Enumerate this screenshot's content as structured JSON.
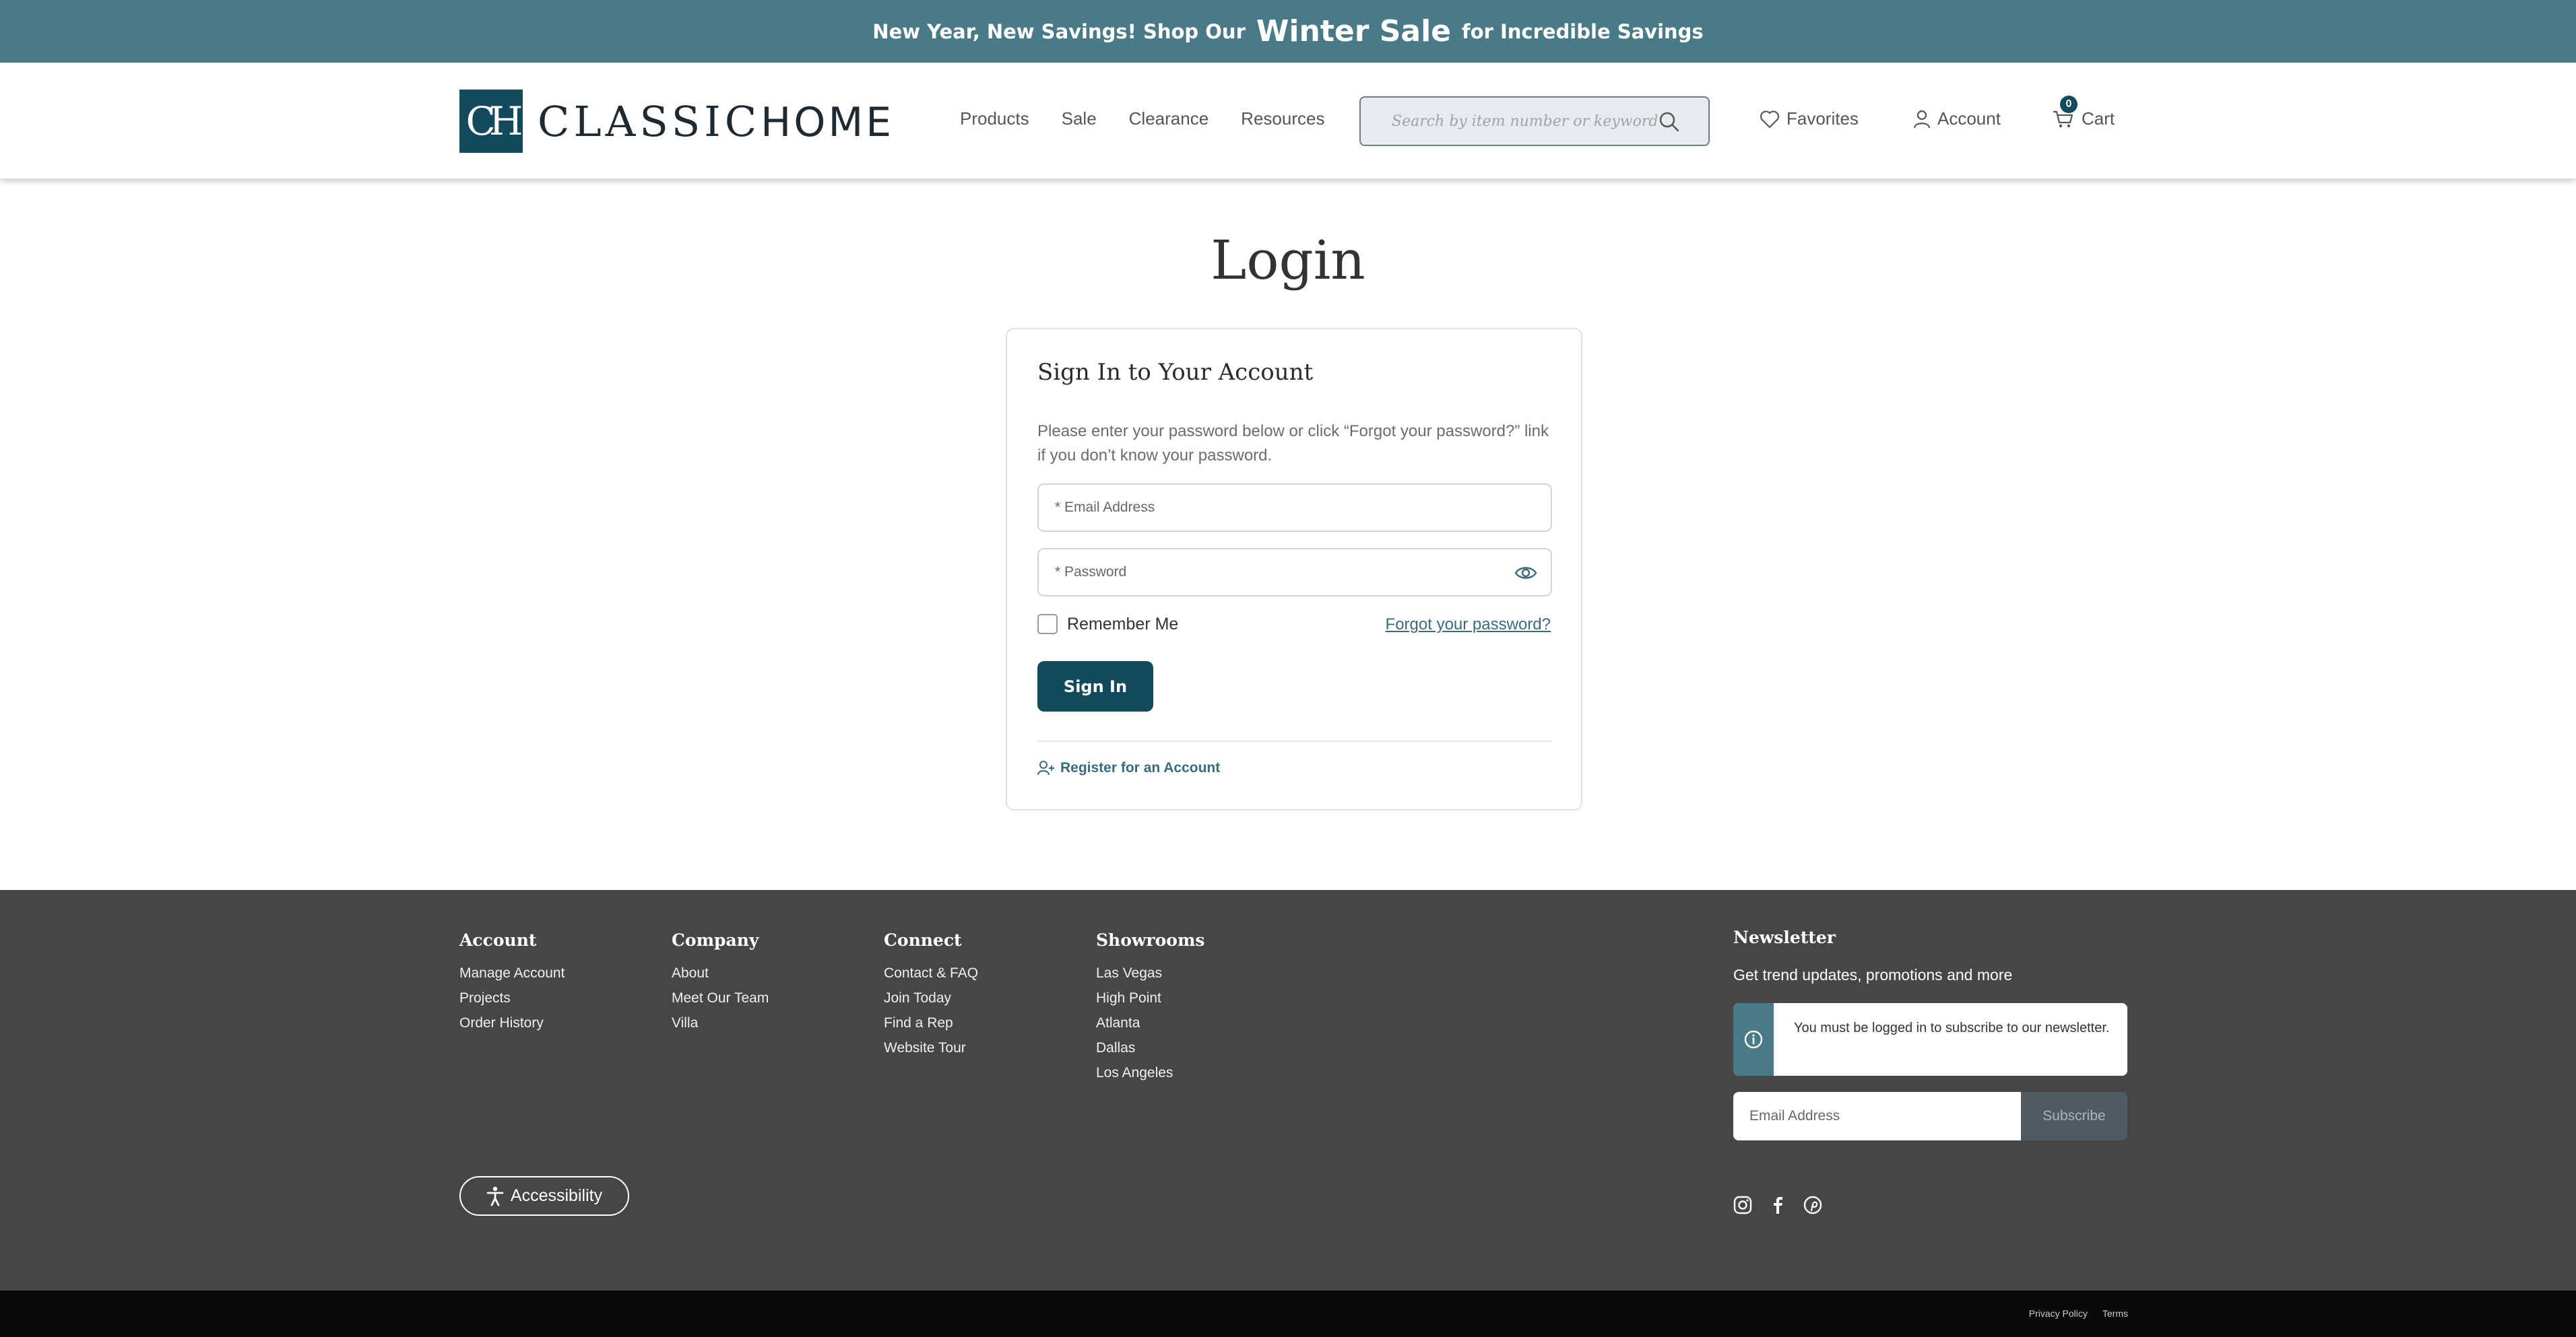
{
  "promo": {
    "prefix": "New Year, New Savings! Shop Our",
    "highlight": "Winter Sale",
    "suffix": "for Incredible Savings"
  },
  "header": {
    "logo_mark": "CH",
    "logo_text_bold": "CLASSIC",
    "logo_text_light": "HOME",
    "nav": [
      "Products",
      "Sale",
      "Clearance",
      "Resources"
    ],
    "search_placeholder": "Search by item number or keyword",
    "favorites_label": "Favorites",
    "account_label": "Account",
    "cart_label": "Cart",
    "cart_count": "0"
  },
  "login": {
    "title": "Login",
    "card_title": "Sign In to Your Account",
    "description": "Please enter your password below or click “Forgot your password?” link if you don’t know your password.",
    "email_placeholder": "* Email Address",
    "password_placeholder": "* Password",
    "remember_label": "Remember Me",
    "forgot_label": "Forgot your password?",
    "signin_label": "Sign In",
    "register_label": "Register for an Account"
  },
  "footer": {
    "columns": [
      {
        "title": "Account",
        "items": [
          "Manage Account",
          "Projects",
          "Order History"
        ]
      },
      {
        "title": "Company",
        "items": [
          "About",
          "Meet Our Team",
          "Villa"
        ]
      },
      {
        "title": "Connect",
        "items": [
          "Contact & FAQ",
          "Join Today",
          "Find a Rep",
          "Website Tour"
        ]
      },
      {
        "title": "Showrooms",
        "items": [
          "Las Vegas",
          "High Point",
          "Atlanta",
          "Dallas",
          "Los Angeles"
        ]
      }
    ],
    "newsletter": {
      "title": "Newsletter",
      "subtitle": "Get trend updates, promotions and more",
      "notice": "You must be logged in to subscribe to our newsletter.",
      "email_placeholder": "Email Address",
      "subscribe_label": "Subscribe"
    },
    "accessibility_label": "Accessibility",
    "socials": [
      "instagram-icon",
      "facebook-icon",
      "pinterest-icon"
    ],
    "legal": [
      "Privacy Policy",
      "Terms"
    ]
  },
  "colors": {
    "brand": "#134a5c",
    "promo_bg": "#4a7987",
    "footer_bg": "#464648",
    "link": "#3a6b7d"
  }
}
